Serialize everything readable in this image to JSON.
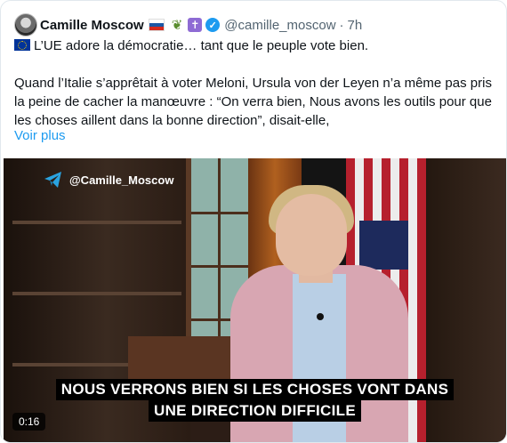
{
  "tweet": {
    "author_name": "Camille Moscow",
    "handle": "@camille_moscow",
    "separator": "·",
    "time": "7h",
    "paragraph1": "L’UE adore la démocratie… tant que le peuple vote bien.",
    "paragraph2": "Quand l’Italie s’apprêtait à voter Meloni, Ursula von der Leyen n’a même pas pris la peine de cacher la manœuvre : “On verra bien, Nous avons les outils pour que les choses aillent dans la bonne direction”, disait-elle,",
    "show_more": "Voir plus"
  },
  "icons": {
    "author_avatar": "avatar-icon",
    "flag_russia": "russia-flag-icon",
    "olive": "olive-branch-icon",
    "orthodox_cross": "orthodox-cross-icon",
    "verified": "verified-badge-icon",
    "flag_eu": "eu-flag-icon",
    "telegram": "telegram-icon"
  },
  "video": {
    "watermark": "@Camille_Moscow",
    "subtitle_line1": "NOUS VERRONS BIEN SI LES CHOSES VONT DANS",
    "subtitle_line2": "UNE DIRECTION DIFFICILE",
    "timestamp": "0:16"
  },
  "colors": {
    "link": "#1d9bf0",
    "verified": "#1d9bf0",
    "secondary_text": "#536471"
  }
}
